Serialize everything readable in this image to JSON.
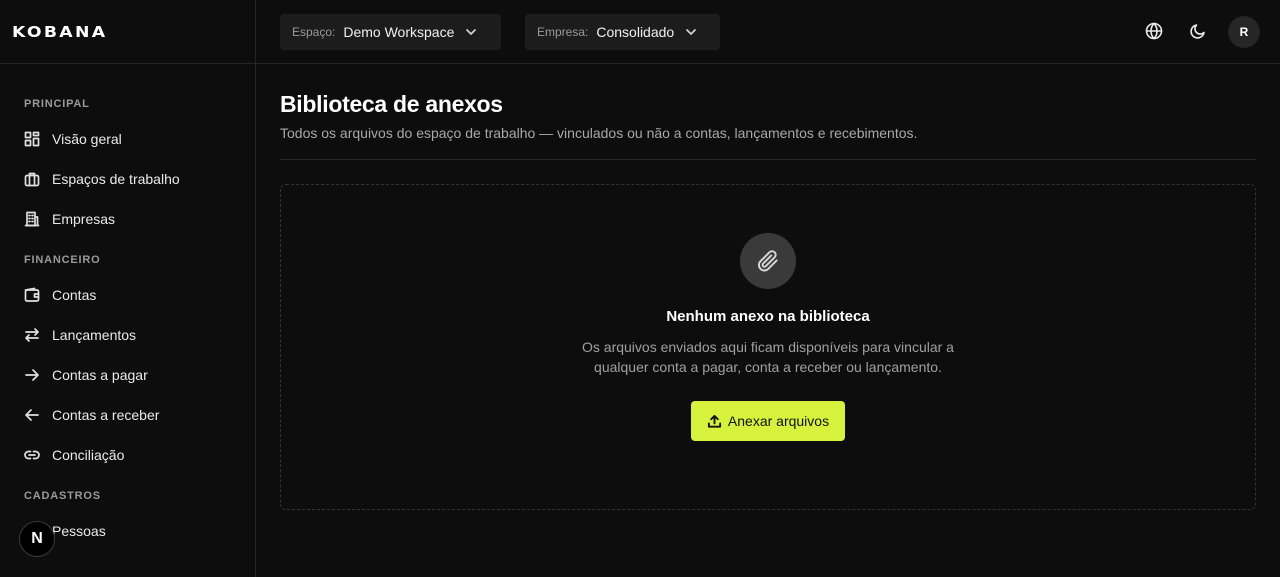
{
  "brand": {
    "logo": "KOBANA"
  },
  "topbar": {
    "workspace": {
      "caption": "Espaço:",
      "value": "Demo Workspace"
    },
    "company": {
      "caption": "Empresa:",
      "value": "Consolidado"
    },
    "avatar_initial": "R"
  },
  "sidebar": {
    "sections": [
      {
        "title": "PRINCIPAL",
        "items": [
          {
            "label": "Visão geral",
            "icon": "dashboard-icon"
          },
          {
            "label": "Espaços de trabalho",
            "icon": "briefcase-icon"
          },
          {
            "label": "Empresas",
            "icon": "building-icon"
          }
        ]
      },
      {
        "title": "FINANCEIRO",
        "items": [
          {
            "label": "Contas",
            "icon": "wallet-icon"
          },
          {
            "label": "Lançamentos",
            "icon": "swap-arrows-icon"
          },
          {
            "label": "Contas a pagar",
            "icon": "arrow-right-icon"
          },
          {
            "label": "Contas a receber",
            "icon": "arrow-left-icon"
          },
          {
            "label": "Conciliação",
            "icon": "link-icon"
          }
        ]
      },
      {
        "title": "CADASTROS",
        "items": [
          {
            "label": "Pessoas",
            "icon": "users-icon"
          }
        ]
      }
    ],
    "badge": "N"
  },
  "main": {
    "title": "Biblioteca de anexos",
    "subtitle": "Todos os arquivos do espaço de trabalho — vinculados ou não a contas, lançamentos e recebimentos.",
    "empty": {
      "title": "Nenhum anexo na biblioteca",
      "description": "Os arquivos enviados aqui ficam disponíveis para vincular a qualquer conta a pagar, conta a receber ou lançamento.",
      "button": "Anexar arquivos"
    }
  },
  "colors": {
    "accent": "#d7f23c",
    "background": "#0d0d0d"
  }
}
